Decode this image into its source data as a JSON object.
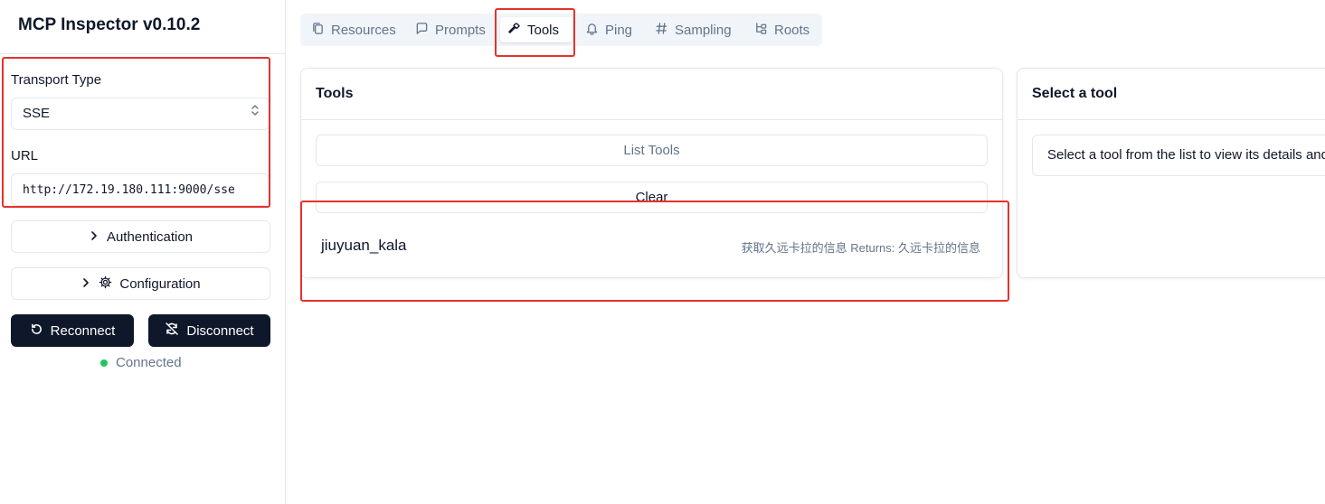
{
  "app": {
    "title": "MCP Inspector v0.10.2"
  },
  "sidebar": {
    "transport_label": "Transport Type",
    "transport_value": "SSE",
    "url_label": "URL",
    "url_value": "http://172.19.180.111:9000/sse",
    "authentication_label": "Authentication",
    "configuration_label": "Configuration",
    "reconnect_label": "Reconnect",
    "disconnect_label": "Disconnect",
    "status_text": "Connected",
    "status_color": "#22c55e"
  },
  "tabs": [
    {
      "label": "Resources",
      "icon": "files-icon"
    },
    {
      "label": "Prompts",
      "icon": "message-square-icon"
    },
    {
      "label": "Tools",
      "icon": "hammer-icon",
      "active": true
    },
    {
      "label": "Ping",
      "icon": "bell-icon"
    },
    {
      "label": "Sampling",
      "icon": "hash-icon"
    },
    {
      "label": "Roots",
      "icon": "folder-tree-icon"
    }
  ],
  "tools_panel": {
    "title": "Tools",
    "list_button": "List Tools",
    "clear_button": "Clear",
    "items": [
      {
        "name": "jiuyuan_kala",
        "description": "获取久远卡拉的信息 Returns: 久远卡拉的信息"
      }
    ]
  },
  "detail_panel": {
    "title": "Select a tool",
    "hint": "Select a tool from the list to view its details and run it"
  },
  "highlight_color": "#e5322d"
}
